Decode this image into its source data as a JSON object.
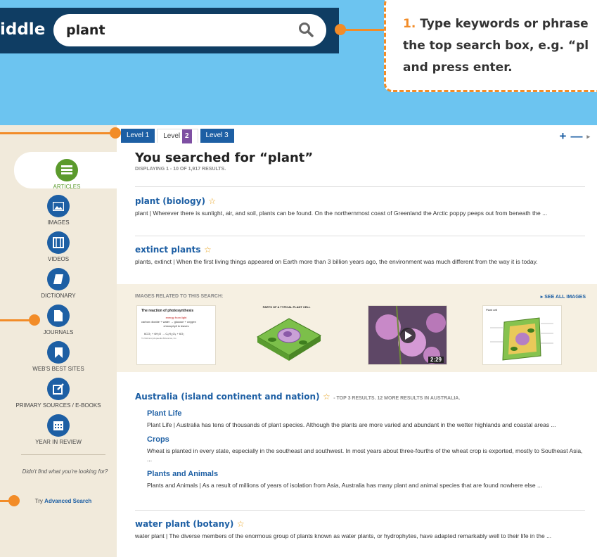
{
  "banner": {
    "label": "iddle",
    "search_value": "plant"
  },
  "callout": {
    "number": "1.",
    "lines": [
      "Type keywords or phrase",
      "the top search box, e.g. “pl",
      "and press enter."
    ]
  },
  "tabs": [
    {
      "label": "Level 1"
    },
    {
      "label": "Level",
      "num": "2"
    },
    {
      "label": "Level 3"
    }
  ],
  "zoom": {
    "plus": "+",
    "minus": "—",
    "arrow": "▸"
  },
  "sidebar": {
    "items": [
      {
        "label": "Articles",
        "icon": "list-icon"
      },
      {
        "label": "Images",
        "icon": "image-icon"
      },
      {
        "label": "Videos",
        "icon": "film-icon"
      },
      {
        "label": "Dictionary",
        "icon": "book-icon"
      },
      {
        "label": "Journals",
        "icon": "document-icon"
      },
      {
        "label": "Web's Best Sites",
        "icon": "bookmark-icon"
      },
      {
        "label": "Primary Sources / E-Books",
        "icon": "edit-icon"
      },
      {
        "label": "Year in Review",
        "icon": "calendar-icon"
      }
    ],
    "nofind": "Didn't find what you're looking for?",
    "try_prefix": "Try",
    "try_link": "Advanced Search"
  },
  "header": {
    "title": "You searched for “plant”",
    "subtitle": "Displaying 1 - 10 of 1,917 results."
  },
  "results": [
    {
      "title": "plant (biology)",
      "snippet": "plant | Wherever there is sunlight, air, and soil, plants can be found. On the northernmost coast of Greenland the Arctic poppy peeps out from beneath the ..."
    },
    {
      "title": "extinct plants",
      "snippet": "plants, extinct | When the first living things appeared on Earth more than 3 billion years ago, the environment was much different from the way it is today."
    }
  ],
  "images": {
    "header": "Images related to this search:",
    "see_all": "See all images",
    "thumbs": [
      {
        "title": "The reaction of photosynthesis",
        "line1": "energy from light",
        "line2": "carbon dioxide + water → glucose + oxygen",
        "line3": "chlorophyll in leaves",
        "eq": "6CO₂ + 6H₂O → C₆H₁₂O₆ + 6O₂",
        "credit": "© 2011 Encyclopaedia Britannica, Inc."
      },
      {
        "title": "PARTS OF A TYPICAL PLANT CELL"
      },
      {
        "duration": "2:29"
      },
      {
        "title": "Plant cell"
      }
    ]
  },
  "australia": {
    "title": "Australia (island continent and nation)",
    "top_note": "- Top 3 results. 12 more results in Australia.",
    "subs": [
      {
        "title": "Plant Life",
        "snippet": "Plant Life | Australia has tens of thousands of plant species. Although the plants are more varied and abundant in the wetter highlands and coastal areas ..."
      },
      {
        "title": "Crops",
        "snippet": "Wheat is planted in every state, especially in the southeast and southwest. In most years about three-fourths of the wheat crop is exported, mostly to Southeast Asia, ..."
      },
      {
        "title": "Plants and Animals",
        "snippet": "Plants and Animals | As a result of millions of years of isolation from Asia, Australia has many plant and animal species that are found nowhere else ..."
      }
    ]
  },
  "water": {
    "title": "water plant (botany)",
    "snippet": "water plant | The diverse members of the enormous group of plants known as water plants, or hydrophytes, have adapted remarkably well to their life in the ..."
  },
  "colors": {
    "accent": "#f28c28",
    "brand": "#1d5fa4",
    "banner": "#0f3d63",
    "background": "#6cc4f0"
  }
}
